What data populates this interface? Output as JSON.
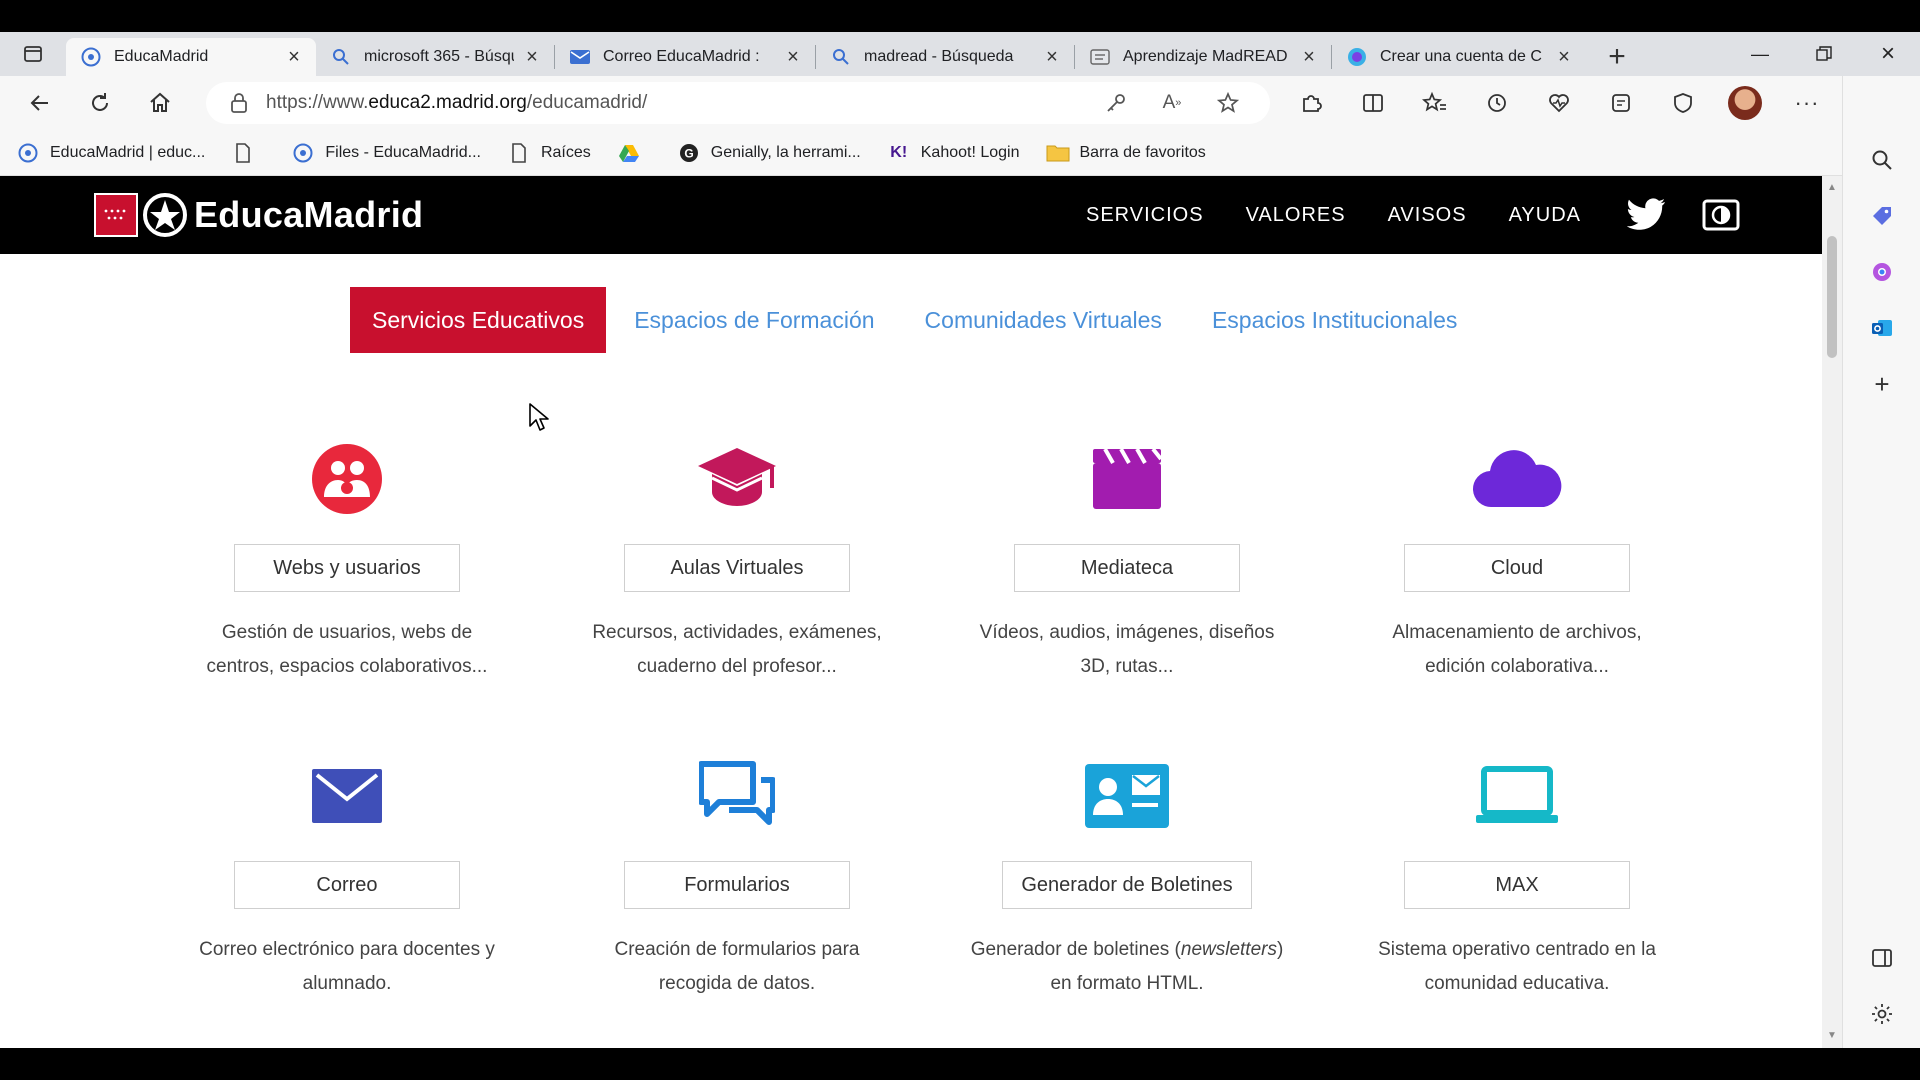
{
  "browser": {
    "tabs": [
      {
        "title": "EducaMadrid",
        "icon": "educamadrid-favicon",
        "active": true
      },
      {
        "title": "microsoft 365 - Búsqu",
        "icon": "search-favicon",
        "active": false
      },
      {
        "title": "Correo EducaMadrid :",
        "icon": "mail-favicon",
        "active": false
      },
      {
        "title": "madread - Búsqueda",
        "icon": "search-favicon",
        "active": false
      },
      {
        "title": "Aprendizaje MadREAD",
        "icon": "madread-favicon",
        "active": false
      },
      {
        "title": "Crear una cuenta de C",
        "icon": "canva-favicon",
        "active": false
      }
    ],
    "url_prefix": "https://www.",
    "url_domain": "educa2.madrid.org",
    "url_path": "/educamadrid/",
    "bookmarks": [
      {
        "label": "EducaMadrid | educ...",
        "icon": "educamadrid-favicon"
      },
      {
        "label": "",
        "icon": "page-icon"
      },
      {
        "label": "Files - EducaMadrid...",
        "icon": "educamadrid-favicon"
      },
      {
        "label": "Raíces",
        "icon": "page-icon"
      },
      {
        "label": "",
        "icon": "google-drive-icon"
      },
      {
        "label": "Genially, la herrami...",
        "icon": "genially-icon"
      },
      {
        "label": "Kahoot! Login",
        "icon": "kahoot-icon"
      },
      {
        "label": "Barra de favoritos",
        "icon": "folder-icon"
      }
    ]
  },
  "site": {
    "logo_text": "EducaMadrid",
    "nav": [
      "SERVICIOS",
      "VALORES",
      "AVISOS",
      "AYUDA"
    ],
    "section_tabs": [
      {
        "label": "Servicios Educativos",
        "active": true
      },
      {
        "label": "Espacios de Formación",
        "active": false
      },
      {
        "label": "Comunidades Virtuales",
        "active": false
      },
      {
        "label": "Espacios Institucionales",
        "active": false
      }
    ],
    "services": [
      {
        "name": "Webs y usuarios",
        "desc1": "Gestión de usuarios, webs de",
        "desc2": "centros, espacios colaborativos...",
        "icon": "users-icon",
        "color": "#e8283c"
      },
      {
        "name": "Aulas Virtuales",
        "desc1": "Recursos, actividades, exámenes,",
        "desc2": "cuaderno del profesor...",
        "icon": "graduation-cap-icon",
        "color": "#c2185b"
      },
      {
        "name": "Mediateca",
        "desc1": "Vídeos, audios, imágenes, diseños",
        "desc2": "3D, rutas...",
        "icon": "clapperboard-icon",
        "color": "#a21caf"
      },
      {
        "name": "Cloud",
        "desc1": "Almacenamiento de archivos,",
        "desc2": "edición colaborativa...",
        "icon": "cloud-icon",
        "color": "#6d28d9"
      },
      {
        "name": "Correo",
        "desc1": "Correo electrónico para docentes y",
        "desc2": "alumnado.",
        "icon": "envelope-icon",
        "color": "#3f4fb8"
      },
      {
        "name": "Formularios",
        "desc1": "Creación de formularios para",
        "desc2": "recogida de datos.",
        "icon": "chat-bubbles-icon",
        "color": "#1e7fd8"
      },
      {
        "name": "Generador de Boletines",
        "desc1": "Generador de boletines (",
        "desc1_em": "newsletters",
        "desc1_end": ")",
        "desc2": "en formato HTML.",
        "icon": "contact-card-icon",
        "color": "#1aa3d9"
      },
      {
        "name": "MAX",
        "desc1": "Sistema operativo centrado en la",
        "desc2": "comunidad educativa.",
        "icon": "laptop-icon",
        "color": "#15b8c8"
      }
    ]
  }
}
